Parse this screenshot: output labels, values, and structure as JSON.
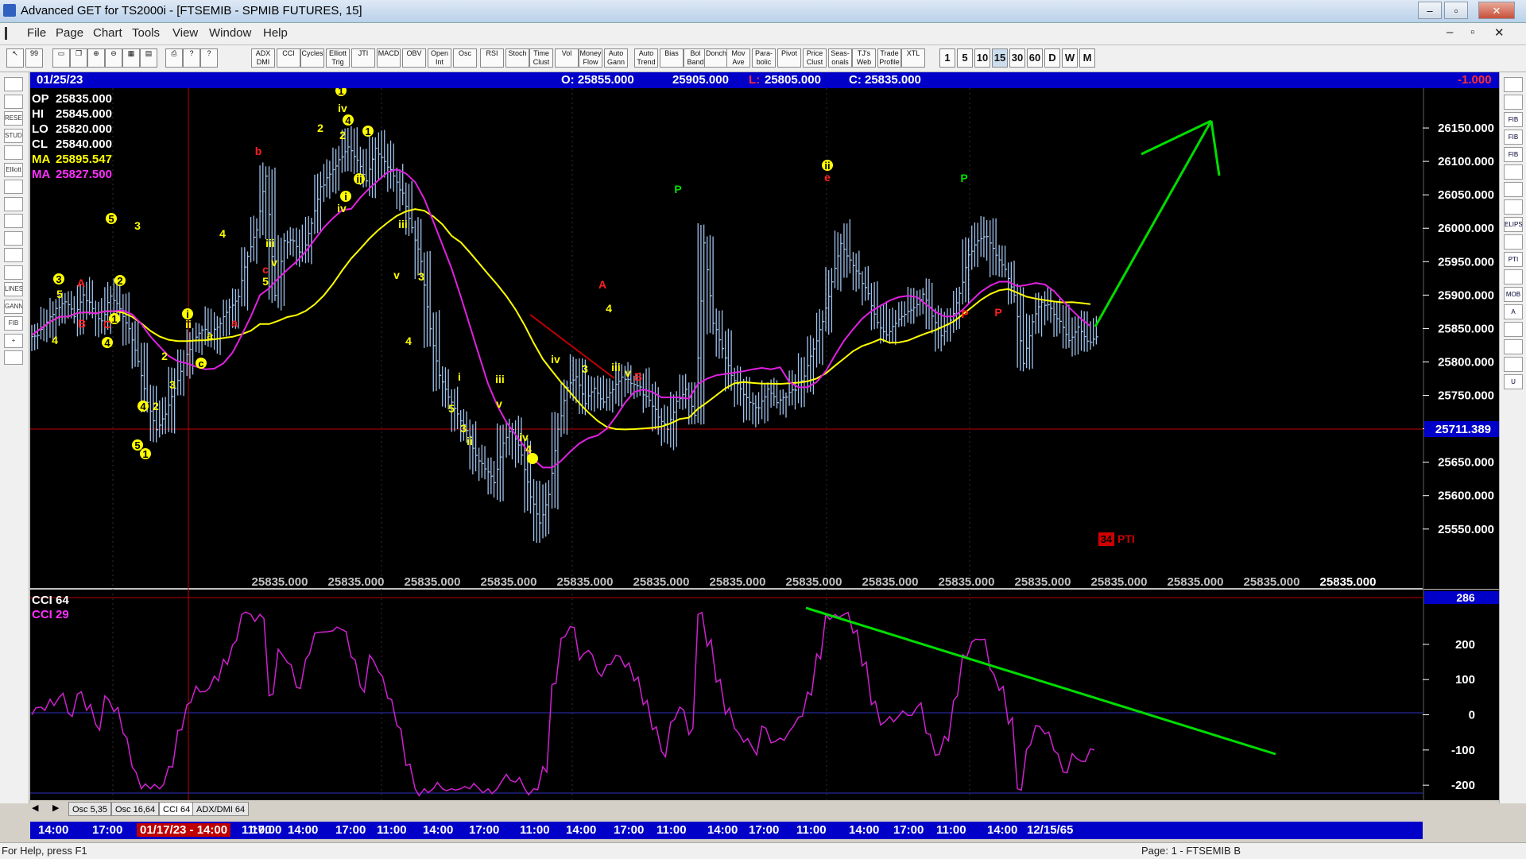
{
  "window": {
    "title": "Advanced GET for TS2000i - [FTSEMIB - SPMIB FUTURES, 15]",
    "controls": [
      "–",
      "▫",
      "✕"
    ],
    "mdi_controls": [
      "–",
      "▫",
      "✕"
    ]
  },
  "menu": [
    "File",
    "Page",
    "Chart",
    "Tools",
    "View",
    "Window",
    "Help"
  ],
  "toolbar": {
    "studies": [
      "ADX DMI",
      "CCI",
      "Cycles",
      "Elliott Trig",
      "JTI",
      "MACD",
      "OBV",
      "Open Int",
      "Osc",
      "RSI",
      "Stoch",
      "Time Clust",
      "Vol",
      "Money Flow",
      "Auto Gann",
      "Auto Trend",
      "Bias",
      "Bol Band",
      "Donch",
      "Mov Ave",
      "Para- bolic",
      "Pivot",
      "Price Clust",
      "Seas- onals",
      "TJ's Web",
      "Trade Profile",
      "XTL"
    ],
    "periods": [
      "1",
      "5",
      "10",
      "15",
      "30",
      "60",
      "D",
      "W",
      "M"
    ]
  },
  "left_tools": [
    "",
    "",
    "RESET",
    "STUDY",
    "",
    "Elliott",
    "",
    "",
    "",
    "",
    "",
    "",
    "LINES",
    "GANN",
    "FIB",
    "+",
    ""
  ],
  "right_tools": [
    "",
    "",
    "FIB RET",
    "FIB EXT",
    "FIB TIME",
    "",
    "",
    "",
    "ELIPS",
    "",
    "PTI",
    "",
    "MOB",
    "A",
    "",
    "",
    "",
    "U"
  ],
  "header": {
    "date": "01/25/23",
    "open": "O: 25855.000",
    "high": "25905.000",
    "low_label": "L:",
    "low": "25805.000",
    "close": "C: 25835.000",
    "change": "-1.000"
  },
  "colors": {
    "price": "#9fc3ee",
    "ma1": "#ffff00",
    "ma2": "#e020e0",
    "cci": "#d020d0",
    "trend": "#00e000",
    "bg": "#000000",
    "label_yellow": "#ffff00",
    "label_red": "#ff2020"
  },
  "price_panel": {
    "info": [
      {
        "label": "OP",
        "value": "25835.000",
        "color": "#ffffff"
      },
      {
        "label": "HI",
        "value": "25845.000",
        "color": "#ffffff"
      },
      {
        "label": "LO",
        "value": "25820.000",
        "color": "#ffffff"
      },
      {
        "label": "CL",
        "value": "25840.000",
        "color": "#ffffff"
      },
      {
        "label": "MA",
        "value": "25895.547",
        "color": "#ffff00"
      },
      {
        "label": "MA",
        "value": "25827.500",
        "color": "#ff30ff"
      }
    ],
    "y_ticks": [
      "26150.000",
      "26100.000",
      "26050.000",
      "26000.000",
      "25950.000",
      "25900.000",
      "25850.000",
      "25800.000",
      "25750.000",
      "25700.000",
      "25650.000",
      "25600.000",
      "25550.000"
    ],
    "y_min": 25520,
    "y_max": 26200,
    "horizontal_level": "25711.389",
    "bottom_values": [
      "25835.000",
      "25835.000",
      "25835.000",
      "25835.000",
      "25835.000",
      "25835.000",
      "25835.000",
      "25835.000",
      "25835.000",
      "25835.000",
      "25835.000",
      "25835.000",
      "25835.000",
      "25835.000",
      "25835.000"
    ],
    "pti": {
      "value": "34",
      "label": "PTI"
    }
  },
  "cci_panel": {
    "title": "CCI 64",
    "subtitle": "CCI  29",
    "y_ticks": [
      "200",
      "100",
      "0",
      "-100",
      "-200"
    ],
    "current": "286"
  },
  "tabs": [
    "Osc 5,35",
    "Osc 16,64",
    "CCI 64",
    "ADX/DMI 64"
  ],
  "tab_active": 2,
  "time_axis": [
    "14:00",
    "17:00",
    "01/17/23 - 14:00",
    "17:00",
    "11:00",
    "14:00",
    "17:00",
    "11:00",
    "14:00",
    "17:00",
    "11:00",
    "14:00",
    "17:00",
    "11:00",
    "14:00",
    "17:00",
    "11:00",
    "14:00",
    "17:00",
    "11:00",
    "14:00",
    "12/15/65"
  ],
  "status": {
    "left": "For Help, press F1",
    "right": "Page: 1 - FTSEMIB B"
  },
  "chart_data": [
    {
      "type": "ohlc",
      "title": "FTSEMIB - SPMIB FUTURES, 15",
      "ylim": [
        25520,
        26200
      ],
      "close_path": [
        25840,
        25860,
        25880,
        25890,
        25870,
        25900,
        25880,
        25860,
        25900,
        25880,
        25850,
        25800,
        25740,
        25700,
        25720,
        25760,
        25800,
        25830,
        25850,
        25840,
        25860,
        25880,
        25900,
        25960,
        26000,
        26080,
        25900,
        25980,
        25980,
        25960,
        26010,
        26060,
        26080,
        26100,
        26120,
        26100,
        26070,
        26120,
        26100,
        26080,
        26050,
        26000,
        25950,
        25850,
        25780,
        25750,
        25720,
        25700,
        25660,
        25640,
        25620,
        25680,
        25700,
        25660,
        25600,
        25560,
        25600,
        25700,
        25760,
        25780,
        25740,
        25760,
        25740,
        25760,
        25780,
        25770,
        25760,
        25740,
        25720,
        25700,
        25740,
        25760,
        25720,
        25980,
        25860,
        25820,
        25780,
        25760,
        25740,
        25730,
        25760,
        25740,
        25750,
        25760,
        25780,
        25820,
        25860,
        25920,
        25980,
        25950,
        25930,
        25900,
        25860,
        25840,
        25860,
        25870,
        25880,
        25900,
        25870,
        25840,
        25860,
        25900,
        25960,
        25980,
        25990,
        25960,
        25940,
        25900,
        25800,
        25860,
        25890,
        25880,
        25860,
        25830,
        25850,
        25830,
        25835
      ],
      "annotations_yellow": [
        "3",
        "5",
        "5",
        "2",
        "1",
        "4",
        "3",
        "4",
        "2",
        "5",
        "1",
        "2",
        "3",
        "i",
        "ii",
        "a",
        "c",
        "4",
        "iii",
        "v",
        "5",
        "2",
        "1",
        "iv",
        "4",
        "2",
        "1",
        "ii",
        "i",
        "iv",
        "iii",
        "v",
        "3",
        "4",
        "i",
        "5",
        "3",
        "ii",
        "iii",
        "v",
        "iv",
        "4"
      ],
      "annotations_red": [
        "A",
        "B",
        "C",
        "b",
        "a",
        "c",
        "A",
        "B",
        "e",
        "P",
        "P"
      ],
      "annotations_green": [
        "P",
        "P"
      ]
    },
    {
      "type": "line",
      "title": "CCI 64",
      "ylim": [
        -220,
        290
      ],
      "levels": [
        100,
        -100
      ]
    }
  ]
}
